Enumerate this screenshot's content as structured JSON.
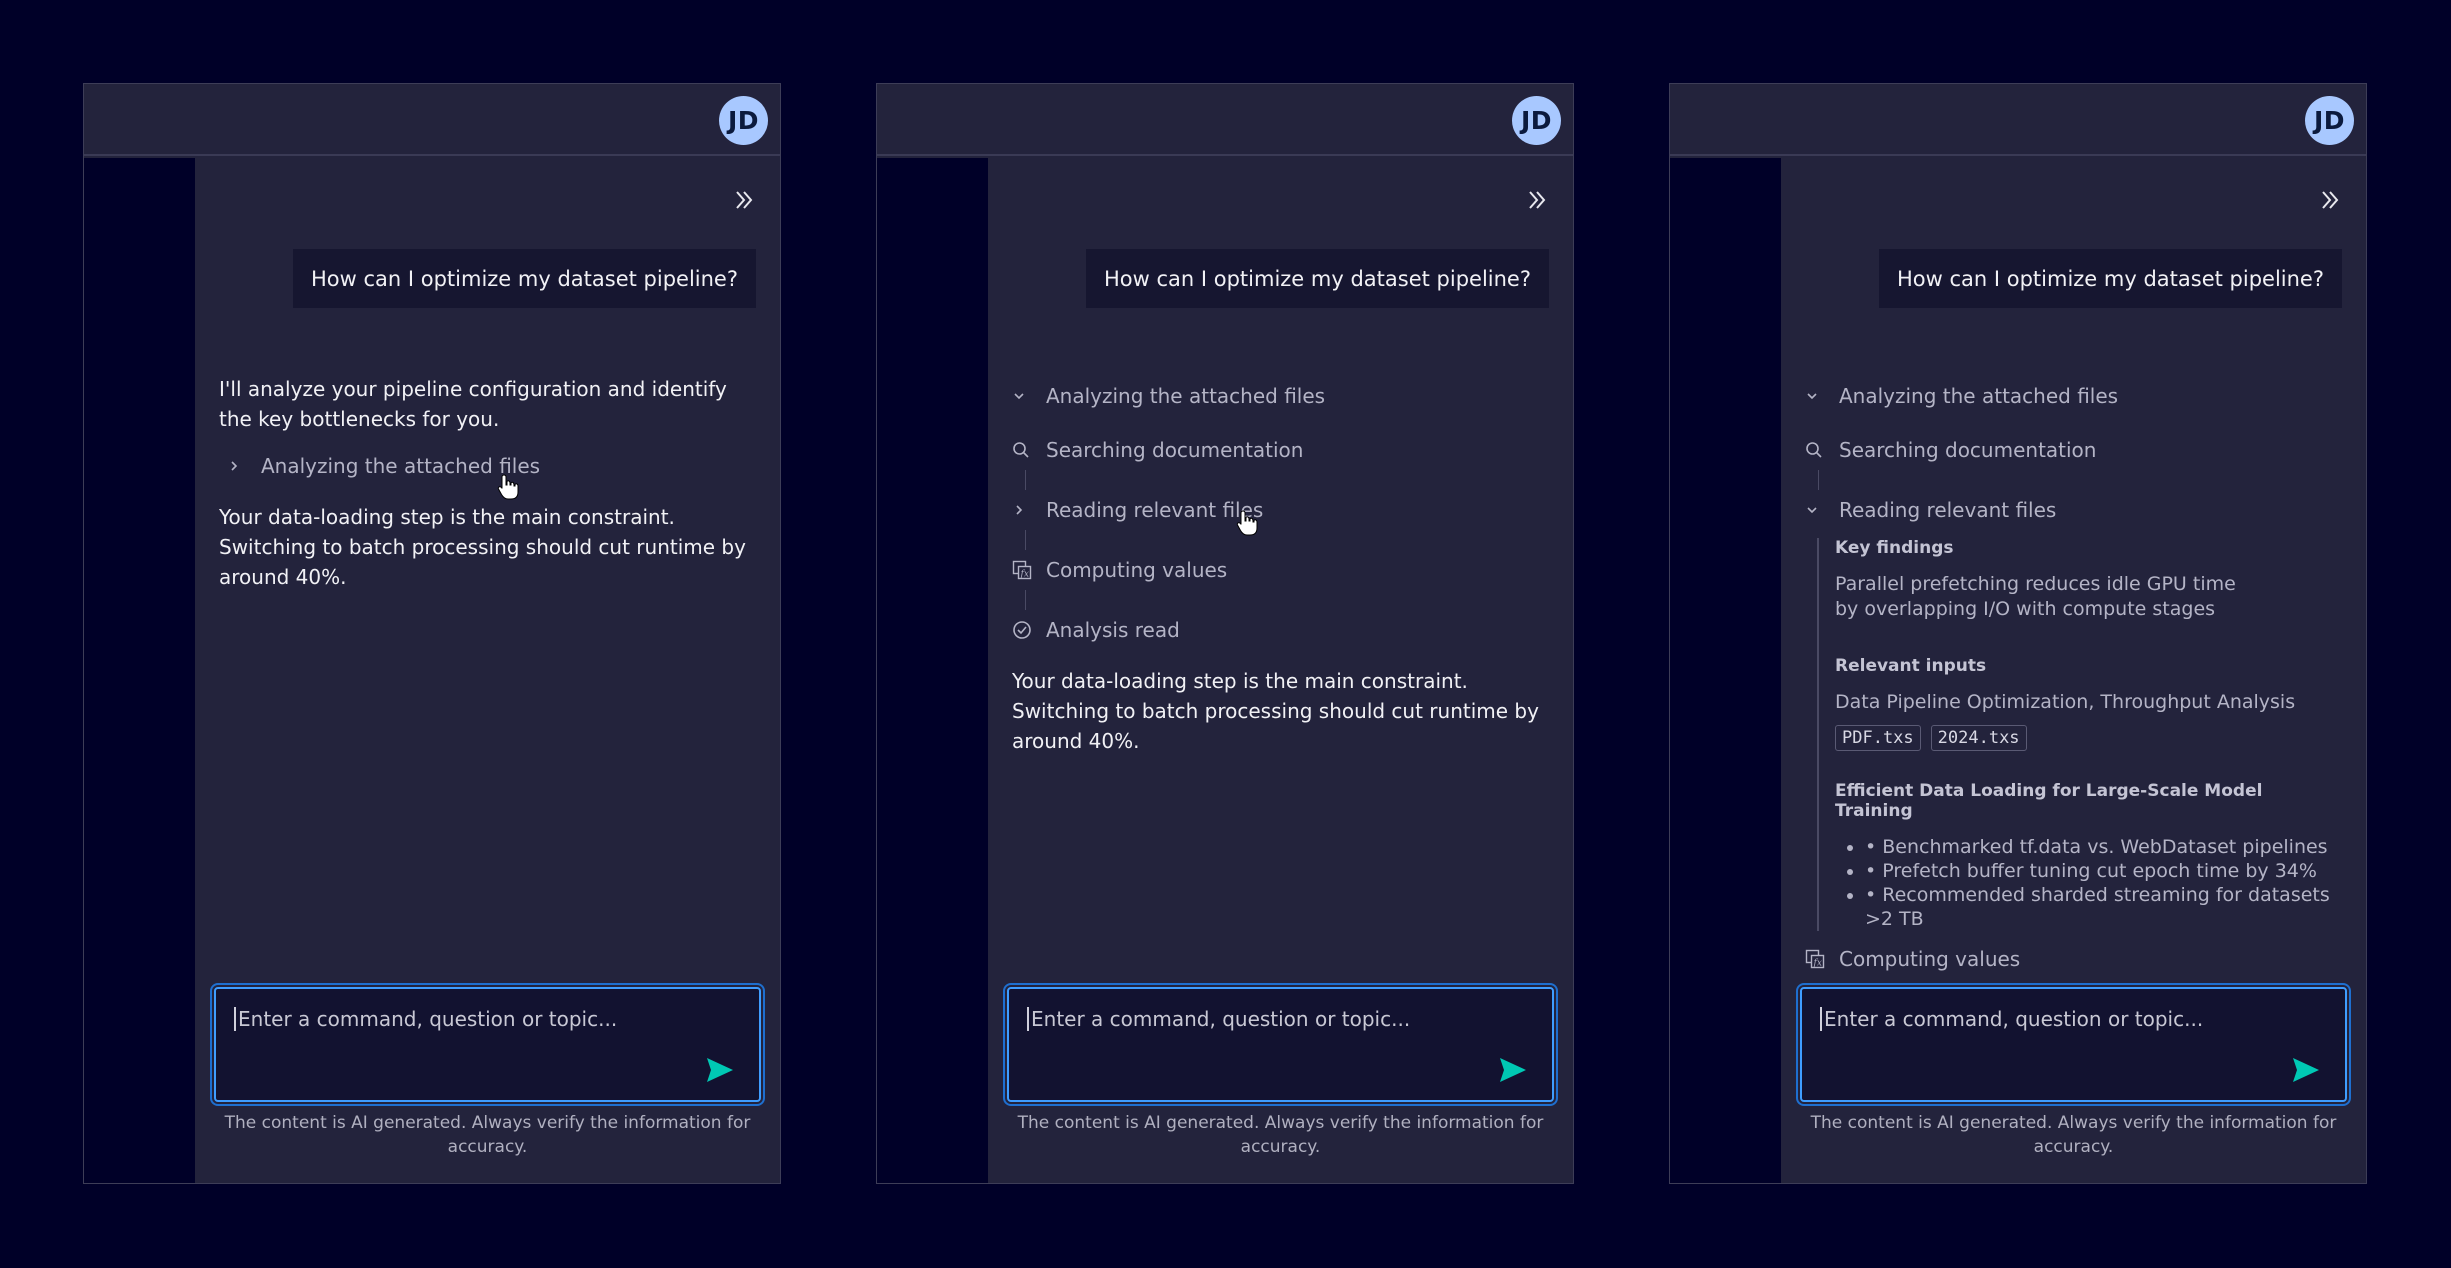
{
  "panels": [
    {
      "avatar": "JD",
      "user_message": "How can I optimize my dataset pipeline?",
      "ai_intro": "I'll analyze your pipeline configuration and identify the key bottlenecks for you.",
      "step_collapsed": "Analyzing the attached files",
      "ai_answer": "Your data-loading step is the main constraint. Switching to batch processing should cut runtime by around 40%.",
      "input_placeholder": "Enter a command, question or topic...",
      "disclaimer": "The content is AI generated. Always verify the information for accuracy."
    },
    {
      "avatar": "JD",
      "user_message": "How can I optimize my dataset pipeline?",
      "steps": [
        {
          "label": "Analyzing the attached files",
          "icon": "chevron-down-icon"
        },
        {
          "label": "Searching documentation",
          "icon": "search-icon"
        },
        {
          "label": "Reading relevant files",
          "icon": "chevron-right-icon"
        },
        {
          "label": "Computing values",
          "icon": "function-icon"
        },
        {
          "label": "Analysis read",
          "icon": "check-circle-icon"
        }
      ],
      "ai_answer": "Your data-loading step is the main constraint. Switching to batch processing should cut runtime by around 40%.",
      "input_placeholder": "Enter a command, question or topic...",
      "disclaimer": "The content is AI generated. Always verify the information for accuracy."
    },
    {
      "avatar": "JD",
      "user_message": "How can I optimize my dataset pipeline?",
      "steps": [
        {
          "label": "Analyzing the attached files",
          "icon": "chevron-down-icon"
        },
        {
          "label": "Searching documentation",
          "icon": "search-icon"
        },
        {
          "label": "Reading relevant files",
          "icon": "chevron-down-icon"
        },
        {
          "label": "Computing values",
          "icon": "function-icon"
        }
      ],
      "details": {
        "key_findings_title": "Key findings",
        "key_findings_text": "Parallel prefetching reduces idle GPU time by overlapping I/O with compute stages",
        "relevant_inputs_title": "Relevant inputs",
        "relevant_inputs_text": "Data Pipeline Optimization, Throughput Analysis",
        "chips": [
          "PDF.txs",
          "2024.txs"
        ],
        "paper_title": "Efficient Data Loading for Large-Scale Model Training",
        "bullets": [
          "• Benchmarked tf.data vs. WebDataset pipelines",
          "• Prefetch buffer tuning cut epoch time by 34%",
          "• Recommended sharded streaming for datasets >2 TB"
        ]
      },
      "input_placeholder": "Enter a command, question or topic...",
      "disclaimer": "The content is AI generated. Always verify the information for accuracy."
    }
  ],
  "colors": {
    "background": "#000028",
    "panel": "#23233c",
    "accent_send": "#00c8b4",
    "input_border": "#3f9dff",
    "avatar": "#a8c8ff"
  }
}
